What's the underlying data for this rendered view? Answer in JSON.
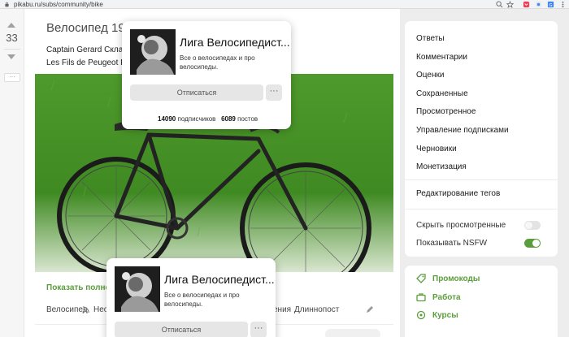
{
  "browser": {
    "url": "pikabu.ru/subs/community/bike",
    "icons": [
      "lock-icon",
      "zoom-icon",
      "star-icon",
      "pocket-icon",
      "extension-icon",
      "translate-icon",
      "profile-icon",
      "menu-icon"
    ]
  },
  "vote": {
    "count": "33",
    "menu_label": "···"
  },
  "post": {
    "title": "Велосипед 1910",
    "line1": "Captain Gerard Складн",
    "line2": "Les Fils de Peugeot Frer",
    "show_full": "Показать полност",
    "tags": [
      "Велосипед",
      "Нео",
      "ения",
      "Длиннопост"
    ]
  },
  "popup_top": {
    "name": "Лига Велосипедист...",
    "desc": "Все о велосипедах и про велосипеды.",
    "button": "Отписаться",
    "more": "···",
    "subscribers": "14090",
    "subscribers_label": "подписчиков",
    "posts": "6089",
    "posts_label": "постов"
  },
  "popup_bottom": {
    "name": "Лига Велосипедист...",
    "desc": "Все о велосипедах и про велосипеды.",
    "button": "Отписаться",
    "more": "···"
  },
  "sidebar": {
    "items": [
      "Ответы",
      "Комментарии",
      "Оценки",
      "Сохраненные",
      "Просмотренное",
      "Управление подписками",
      "Черновики",
      "Монетизация"
    ],
    "edit_tags": "Редактирование тегов",
    "hide_viewed": "Скрыть просмотренные",
    "show_nsfw": "Показывать NSFW",
    "hide_viewed_on": false,
    "show_nsfw_on": true,
    "accent": "#5a9e3b"
  },
  "links": {
    "promocodes": "Промокоды",
    "work": "Работа",
    "courses": "Курсы"
  }
}
